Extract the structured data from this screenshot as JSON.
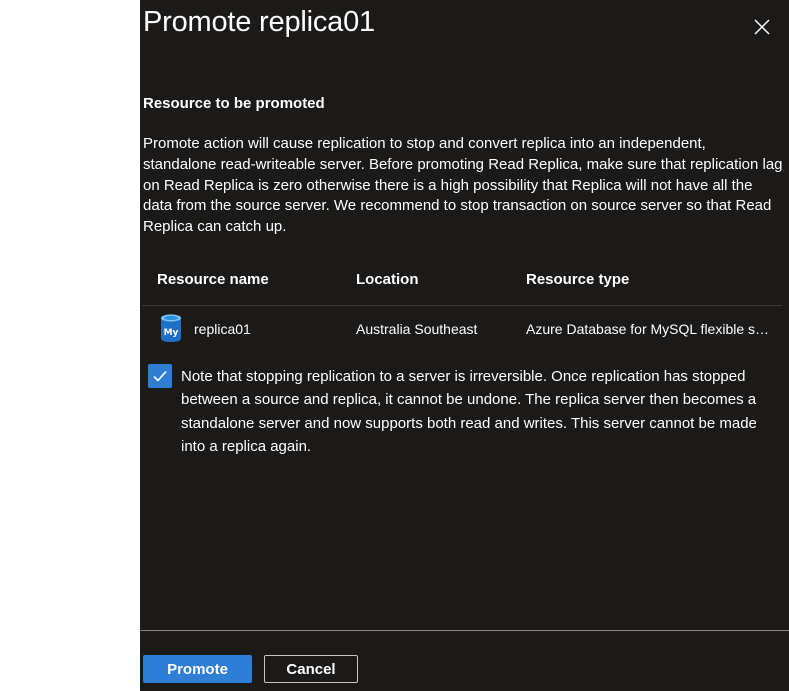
{
  "panel": {
    "title": "Promote replica01",
    "close_icon": "close-icon"
  },
  "section": {
    "heading": "Resource to be promoted",
    "description": "Promote action will cause replication to stop and convert replica into an independent, standalone read-writeable server. Before promoting Read Replica, make sure that replication lag on Read Replica is zero otherwise there is a high possibility that Replica will not have all the data from the source server. We recommend to stop transaction on source server so that Read Replica can catch up."
  },
  "table": {
    "headers": [
      "Resource name",
      "Location",
      "Resource type"
    ],
    "rows": [
      {
        "icon": "mysql-database-icon",
        "icon_label": "My",
        "name": "replica01",
        "location": "Australia Southeast",
        "type": "Azure Database for MySQL flexible server"
      }
    ]
  },
  "acknowledgement": {
    "checked": true,
    "text": "Note that stopping replication to a server is irreversible. Once replication has stopped between a source and replica, it cannot be undone. The replica server then becomes a standalone server and now supports both read and writes. This server cannot be made into a replica again."
  },
  "footer": {
    "promote_label": "Promote",
    "cancel_label": "Cancel"
  },
  "colors": {
    "panel_background": "#1b1a19",
    "accent": "#2f7ed6",
    "divider": "#3b3a39",
    "secondary_border": "#c8c6c4"
  }
}
